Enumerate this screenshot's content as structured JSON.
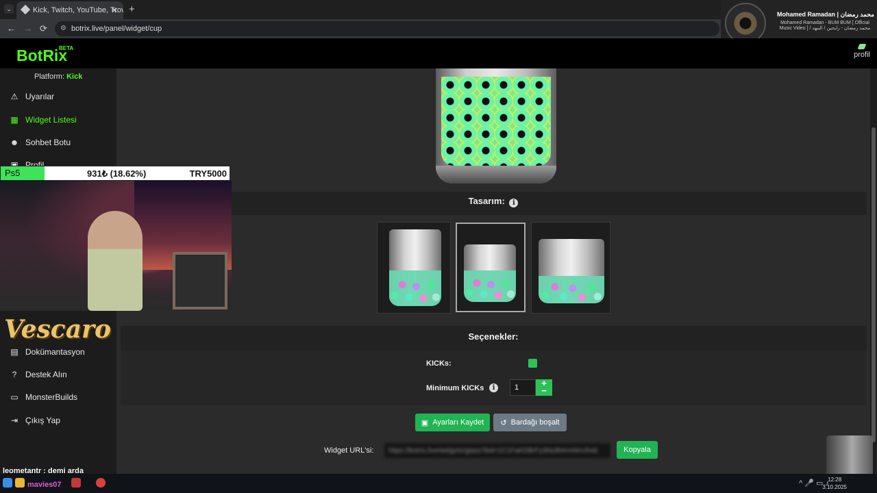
{
  "browser": {
    "tab_title": "Kick, Twitch, YouTube, Trovo ve",
    "tab_close": "✕",
    "new_tab": "+",
    "url": "botrix.live/panel/widget/cup",
    "back": "←",
    "forward": "→",
    "reload": "⟳"
  },
  "media_player": {
    "title": "Mohamed Ramadan | محمد رمضان",
    "subtitle": "Mohamed Ramadan - BUM BUM [ Official Music Video ] / محمد رمضان - رايحين / البنهد"
  },
  "app": {
    "logo": "BotRix",
    "beta": "BETA",
    "profile_label": "profil"
  },
  "sidebar": {
    "platform_label": "Platform:",
    "platform_value": "Kick",
    "items": [
      {
        "label": "Uyarılar",
        "icon": "warning-icon"
      },
      {
        "label": "Widget Listesi",
        "icon": "grid-icon",
        "active": true
      },
      {
        "label": "Sohbet Botu",
        "icon": "robot-icon"
      },
      {
        "label": "Profil",
        "icon": "profile-icon"
      },
      {
        "label": "Dokümantasyon",
        "icon": "docs-icon"
      },
      {
        "label": "Destek Alın",
        "icon": "help-icon"
      },
      {
        "label": "MonsterBuilds",
        "icon": "laptop-icon"
      },
      {
        "label": "Çıkış Yap",
        "icon": "signout-icon"
      }
    ]
  },
  "main": {
    "design_title": "Tasarım:",
    "options_title": "Seçenekler:",
    "kicks_label": "KICKs:",
    "kicks_enabled": true,
    "min_kicks_label": "Minimum KICKs",
    "min_kicks_value": "1",
    "plus": "+",
    "minus": "−",
    "save_button": "Ayarları Kaydet",
    "empty_button": "Bardağı boşalt",
    "widget_url_label": "Widget URL'si:",
    "widget_url_value": "https://botrix.live/widgets/glass?bid=1C1FaKDBrFy3Nc8hKmNmJhsb",
    "copy_button": "Kopyala",
    "cup_designs": [
      "cup-tall",
      "cup-short",
      "cup-wide"
    ],
    "selected_design": 1
  },
  "stream_overlay": {
    "goal_name": "Ps5",
    "goal_progress_text": "931₺ (18.62%)",
    "goal_progress": 18.62,
    "goal_target": "TRY5000",
    "brand": "Vescaro",
    "chat_user": "leometantr",
    "chat_message": "demi arda",
    "taskbar_user": "mavies07"
  },
  "system": {
    "time": "12:28",
    "date": "3.10.2025"
  },
  "colors": {
    "accent": "#53fc18",
    "button_green": "#22b454",
    "button_gray": "#6c7a86"
  }
}
